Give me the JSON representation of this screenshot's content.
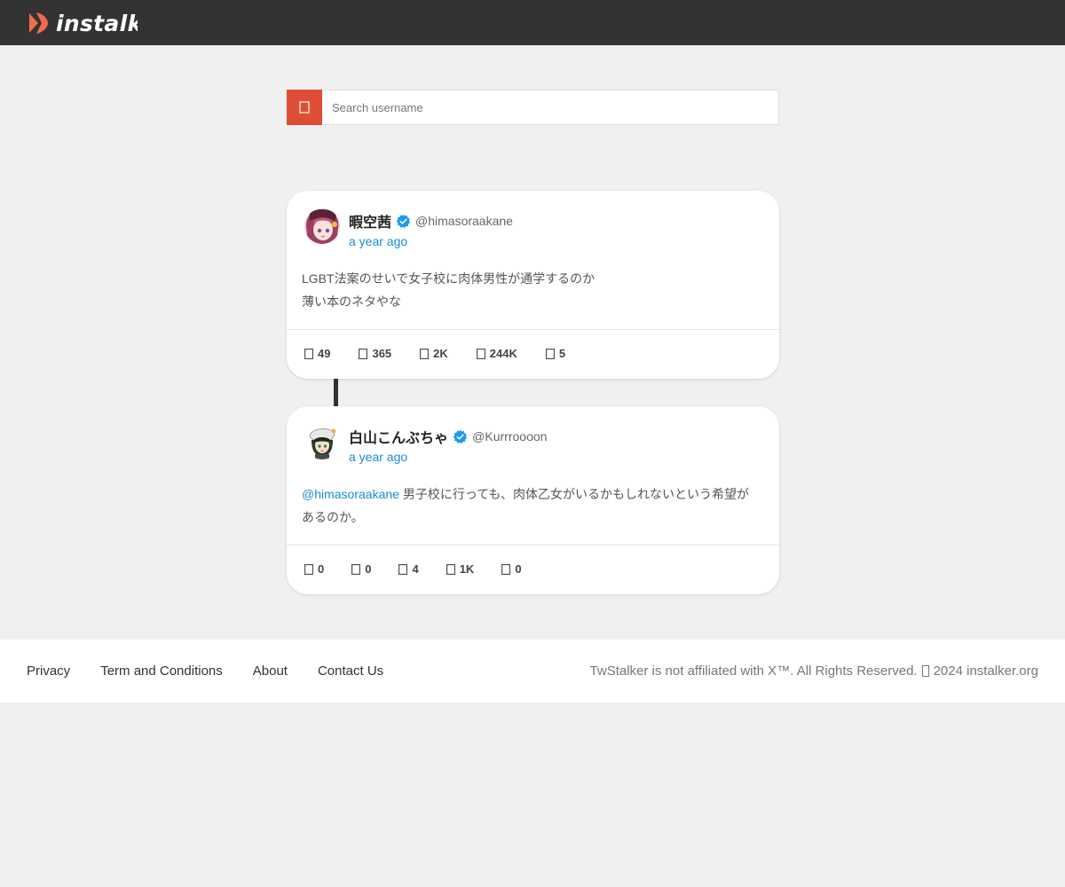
{
  "header": {
    "logo_text": "instalker",
    "brand_color": "#f26b4f",
    "background": "#333333"
  },
  "search": {
    "placeholder": "Search username",
    "icon": "search-icon",
    "button_color": "#e04d35"
  },
  "tweets": [
    {
      "display_name": "暇空茜",
      "verified": true,
      "handle": "@himasoraakane",
      "time": "a year ago",
      "text_lines": [
        "LGBT法案のせいで女子校に肉体男性が通学するのか",
        "薄い本のネタやな"
      ],
      "stats": {
        "replies": "49",
        "retweets": "365",
        "likes": "2K",
        "views": "244K",
        "bookmarks": "5"
      }
    },
    {
      "display_name": "白山こんぶちゃ",
      "verified": true,
      "handle": "@Kurrroooon",
      "time": "a year ago",
      "mention": "@himasoraakane",
      "text_line1": " 男子校に行っても、肉体乙女がいるかもしれないという希望が",
      "text_line2": "あるのか。",
      "stats": {
        "replies": "0",
        "retweets": "0",
        "likes": "4",
        "views": "1K",
        "bookmarks": "0"
      }
    }
  ],
  "footer": {
    "links": [
      "Privacy",
      "Term and Conditions",
      "About",
      "Contact Us"
    ],
    "copyright_before": "TwStalker is not affiliated with X™. All Rights Reserved.",
    "copyright_after": "2024 instalker.org"
  },
  "colors": {
    "accent": "#e04d35",
    "link": "#1a8cd8",
    "verified": "#1d9bf0"
  }
}
